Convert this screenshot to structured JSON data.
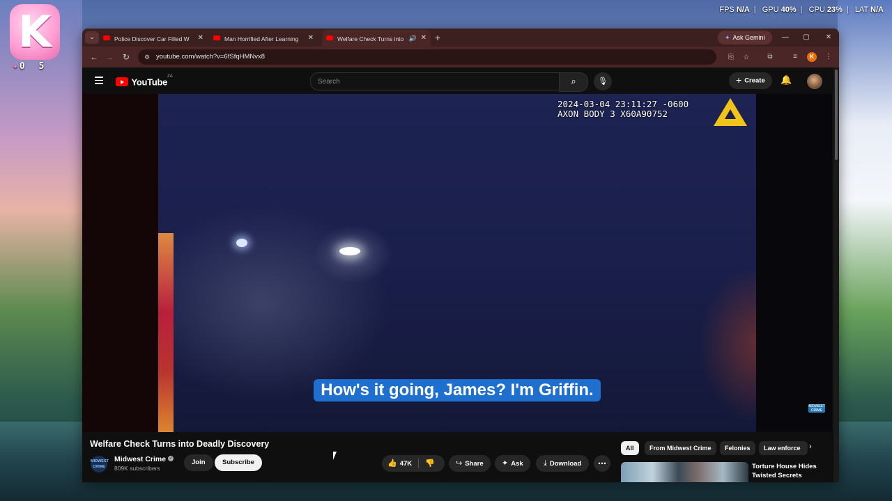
{
  "desktop": {
    "logo_letter": "K",
    "counter": "0 5",
    "overlay": {
      "fps_label": "FPS",
      "fps_value": "N/A",
      "gpu_label": "GPU",
      "gpu_value": "40%",
      "cpu_label": "CPU",
      "cpu_value": "23%",
      "lat_label": "LAT",
      "lat_value": "N/A"
    }
  },
  "browser": {
    "tabs": [
      {
        "title": "Police Discover Car Filled With",
        "active": false
      },
      {
        "title": "Man Horrified After Learning G",
        "active": false
      },
      {
        "title": "Welfare Check Turns into D",
        "active": true
      }
    ],
    "ask_gemini": "Ask Gemini",
    "url": "youtube.com/watch?v=6fSfqHMNvx8",
    "profile_letter": "K"
  },
  "youtube": {
    "logo_text": "YouTube",
    "country_code": "ZA",
    "search_placeholder": "Search",
    "create_label": "Create",
    "video": {
      "timestamp_line1": "2024-03-04 23:11:27 -0600",
      "timestamp_line2": "AXON BODY 3 X60A90752",
      "subtitle": "How's it going, James? I'm Griffin.",
      "watermark": "MIDWEST CRIME"
    },
    "title": "Welfare Check Turns into Deadly Discovery",
    "channel": {
      "name": "Midwest Crime",
      "subscribers": "809K subscribers",
      "avatar_text": "MIDWEST CRIME"
    },
    "actions": {
      "join": "Join",
      "subscribe": "Subscribe",
      "likes": "47K",
      "share": "Share",
      "ask": "Ask",
      "download": "Download"
    },
    "chips": [
      "All",
      "From Midwest Crime",
      "Felonies",
      "Law enforce"
    ],
    "related": [
      {
        "title": "Torture House Hides Twisted Secrets"
      }
    ]
  },
  "colors": {
    "tabbar": "#3c1f1f",
    "addrbar": "#4a2626",
    "yt_red": "#ff0000",
    "subtitle_bg": "#1f6fcf",
    "axon_yellow": "#f2c318"
  }
}
